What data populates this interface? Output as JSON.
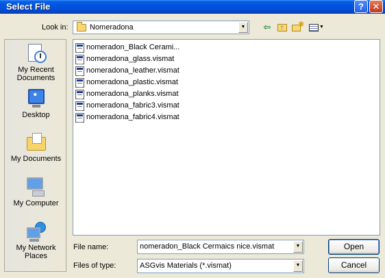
{
  "window": {
    "title": "Select File",
    "help_glyph": "?",
    "close_glyph": "✕"
  },
  "lookin": {
    "label": "Look in:",
    "value": "Nomeradona"
  },
  "toolbar": {
    "back_glyph": "⇦",
    "icons": [
      "back-icon",
      "up-folder-icon",
      "new-folder-icon",
      "views-menu-icon"
    ]
  },
  "places": [
    {
      "label": "My Recent Documents",
      "icon": "recent-documents-icon"
    },
    {
      "label": "Desktop",
      "icon": "desktop-icon"
    },
    {
      "label": "My Documents",
      "icon": "my-documents-icon"
    },
    {
      "label": "My Computer",
      "icon": "my-computer-icon"
    },
    {
      "label": "My Network Places",
      "icon": "network-places-icon"
    }
  ],
  "files": [
    "nomeradon_Black Cerami...",
    "nomeradona_glass.vismat",
    "nomeradona_leather.vismat",
    "nomeradona_plastic.vismat",
    "nomeradona_planks.vismat",
    "nomeradona_fabric3.vismat",
    "nomeradona_fabric4.vismat"
  ],
  "filename": {
    "label": "File name:",
    "value": "nomeradon_Black Cermaics nice.vismat"
  },
  "filetype": {
    "label": "Files of type:",
    "value": "ASGvis Materials (*.vismat)"
  },
  "buttons": {
    "open": "Open",
    "cancel": "Cancel"
  },
  "colors": {
    "titlebar": "#0054E3",
    "dialog_bg": "#ECE9D8",
    "field_border": "#7F9DB9"
  }
}
